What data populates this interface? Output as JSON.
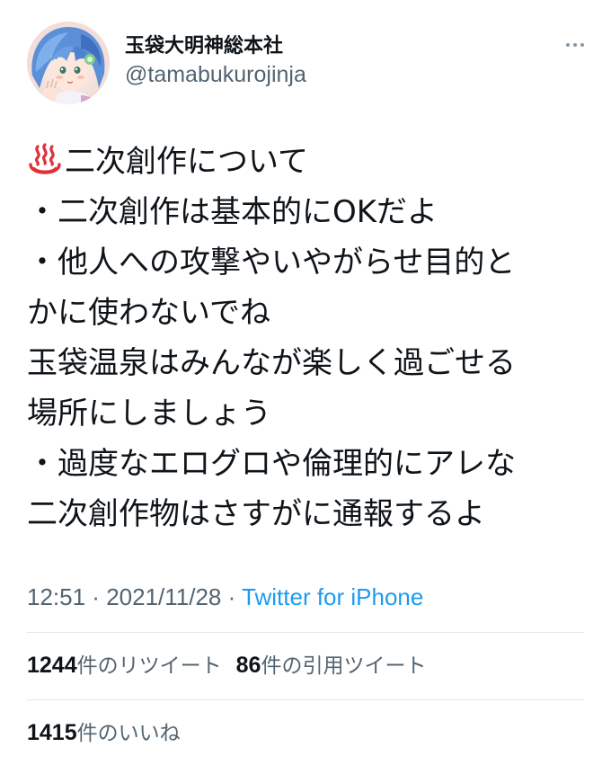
{
  "account": {
    "display_name": "玉袋大明神総本社",
    "handle": "@tamabukurojinja",
    "avatar_icon": "character-avatar-icon"
  },
  "more_menu": {
    "icon": "more-options-icon"
  },
  "tweet": {
    "emoji": "hot-springs-emoji",
    "lines": [
      "二次創作について",
      "・二次創作は基本的にOKだよ",
      "・他人への攻撃やいやがらせ目的と",
      "かに使わないでね",
      "玉袋温泉はみんなが楽しく過ごせる",
      "場所にしましょう",
      "・過度なエログロや倫理的にアレな",
      "二次創作物はさすがに通報するよ"
    ]
  },
  "meta": {
    "time": "12:51",
    "separator1": " · ",
    "date": "2021/11/28",
    "separator2": " · ",
    "source": "Twitter for iPhone"
  },
  "stats": {
    "retweets_count": "1244",
    "retweets_label": "件のリツイート",
    "quotes_count": "86",
    "quotes_label": "件の引用ツイート",
    "likes_count": "1415",
    "likes_label": "件のいいね"
  },
  "colors": {
    "text": "#0f1419",
    "secondary": "#536471",
    "link": "#1d9bf0",
    "divider": "#e1e8ed",
    "emoji_red": "#e0303a"
  }
}
